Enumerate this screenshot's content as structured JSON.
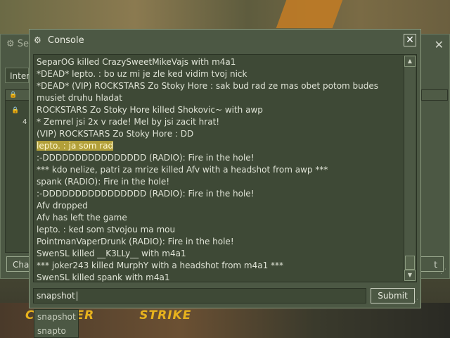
{
  "background_window": {
    "title": "Se",
    "tab_label": "Inter",
    "row_count": "4",
    "change_button": "Cha",
    "right_button": "t"
  },
  "console": {
    "title": "Console",
    "close_glyph": "✕",
    "lines": [
      "SeparOG killed CrazySweetMikeVajs with m4a1",
      "*DEAD* lepto. : bo uz mi je zle ked vidim tvoj nick",
      "*DEAD* (VIP) ROCKSTARS Zo Stoky Hore : sak bud rad ze mas obet potom budes musiet druhu hladat",
      "ROCKSTARS Zo Stoky Hore killed Shokovic~ with awp",
      "* Zemrel jsi 2x v rade! Mel by jsi zacit hrat!",
      "(VIP) ROCKSTARS Zo Stoky Hore : DD",
      "lepto. : ja som rad",
      ":-DDDDDDDDDDDDDDDD (RADIO): Fire in the hole!",
      "*** kdo nelize, patri za mrize killed Afv with a headshot from awp ***",
      "spank (RADIO): Fire in the hole!",
      ":-DDDDDDDDDDDDDDDD (RADIO): Fire in the hole!",
      "Afv dropped",
      "Afv has left the game",
      "lepto. : ked som stvojou ma mou",
      "PointmanVaperDrunk (RADIO): Fire in the hole!",
      "SwenSL killed __K3LLy__ with m4a1",
      "*** joker243 killed MurphY with a headshot from m4a1 ***",
      "SwenSL killed spank with m4a1"
    ],
    "highlighted_line_index": 6,
    "input_value": "snapshot",
    "submit_label": "Submit"
  },
  "autocomplete": {
    "options": [
      "snapshot",
      "snapto"
    ]
  },
  "logo": {
    "left": "COUNTER",
    "right": "STRIKE"
  },
  "colors": {
    "panel": "#4c5844",
    "panel_dark": "#3e4936",
    "highlight": "#b2a03a",
    "logo": "#e7b21d"
  }
}
